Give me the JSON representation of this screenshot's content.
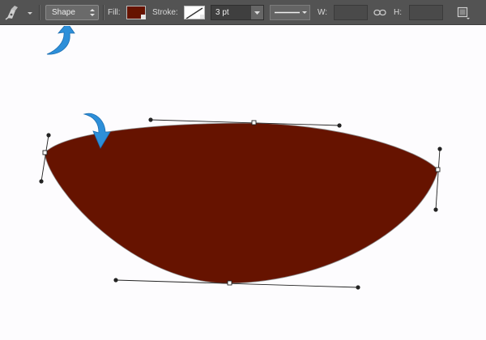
{
  "toolbar": {
    "mode": "Shape",
    "fill_label": "Fill:",
    "fill_color": "#661300",
    "stroke_label": "Stroke:",
    "stroke_width": "3 pt",
    "width_label": "W:",
    "height_label": "H:"
  },
  "icons": {
    "tool": "pen-tool-icon",
    "link": "link-icon",
    "path_operations": "path-operations-icon",
    "annotation": "blue-curved-arrow"
  },
  "colors": {
    "toolbar_bg": "#535353",
    "shape_fill": "#661300",
    "annotation_arrow": "#2d8fd9"
  }
}
